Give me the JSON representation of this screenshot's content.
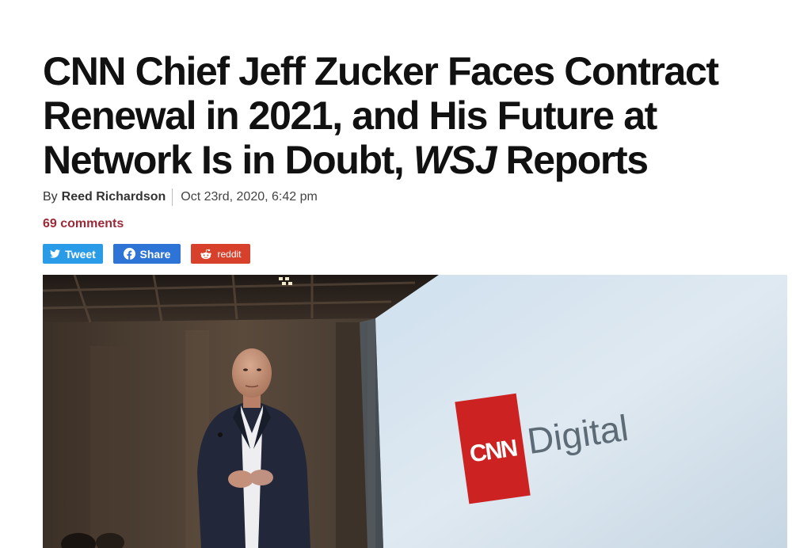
{
  "article": {
    "headline_part1": "CNN Chief Jeff Zucker Faces Contract Renewal in 2021, and His Future at Network Is in Doubt, ",
    "headline_italic": "WSJ",
    "headline_part2": " Reports",
    "byline_prefix": "By",
    "author": "Reed Richardson",
    "date": "Oct 23rd, 2020, 6:42 pm",
    "comments": "69 comments"
  },
  "share": {
    "tweet_label": "Tweet",
    "share_label": "Share",
    "reddit_label": "reddit"
  },
  "photo": {
    "sign_logo": "CNN",
    "sign_text": "Digital"
  },
  "colors": {
    "tweet": "#2a9be6",
    "facebook": "#2e73d6",
    "reddit": "#d7412c",
    "comments": "#9b2a38",
    "cnn_red": "#cc2222"
  }
}
